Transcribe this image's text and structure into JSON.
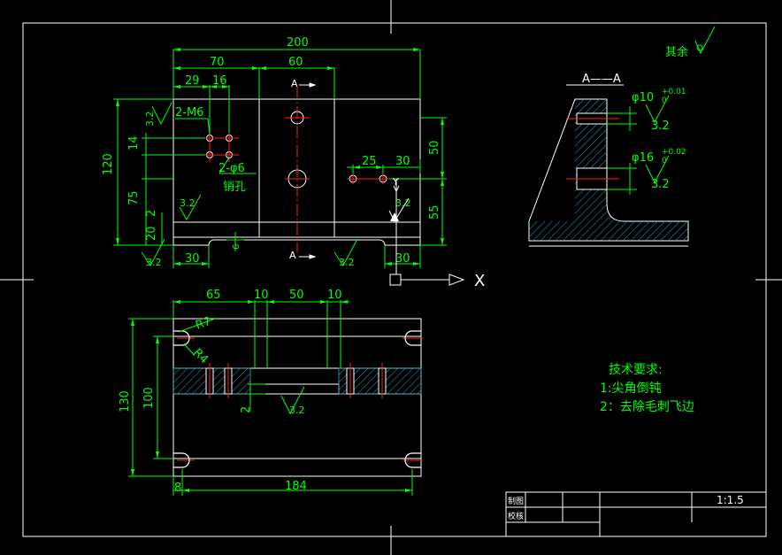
{
  "colors": {
    "background": "#000000",
    "outline": "#ffffff",
    "dimension": "#00ff00",
    "centerline": "#ff0000",
    "hatch": "#2fa8c8"
  },
  "dims": {
    "top_overall": "200",
    "top_70": "70",
    "top_60": "60",
    "top_29": "29",
    "top_16": "16",
    "thread_note": "2-M6",
    "pin_note": "2-φ6",
    "pin_hole_label": "销孔",
    "left_120": "120",
    "left_75": "75",
    "left_14": "14",
    "left_20": "20",
    "left_2": "2",
    "right_50": "50",
    "right_55": "55",
    "mid_25": "25",
    "mid_30": "30",
    "bot_30_left": "30",
    "bot_30_right": "30",
    "slot_6": "6",
    "front_65": "65",
    "front_10a": "10",
    "front_50": "50",
    "front_10b": "10",
    "front_130": "130",
    "front_100": "100",
    "front_2": "2",
    "front_8": "8",
    "front_184": "184",
    "r7": "R7",
    "r4": "R4"
  },
  "roughness": {
    "r1": "3.2",
    "r2": "3.2",
    "r3": "3.2",
    "r4": "3.2",
    "r5": "3.2",
    "r6": "3.2",
    "r7": "3.2",
    "r8": "3.2"
  },
  "section": {
    "section_label": "A——A",
    "hole1": "φ10",
    "hole1_tol_upper": "+0.01",
    "hole1_tol_lower": "0",
    "hole2": "φ16",
    "hole2_tol_upper": "+0.02",
    "hole2_tol_lower": "0",
    "rough1": "3.2",
    "rough2": "3.2"
  },
  "markers": {
    "a_top": "A",
    "a_bottom": "A",
    "axis_x": "X",
    "axis_y": "Y"
  },
  "notes": {
    "rest": "其余",
    "tech_title": "技术要求:",
    "tech_1": "1:尖角倒钝",
    "tech_2": "2：去除毛刺飞边"
  },
  "title_block": {
    "drawn": "制图",
    "checked": "校核",
    "scale": "1:1.5"
  }
}
